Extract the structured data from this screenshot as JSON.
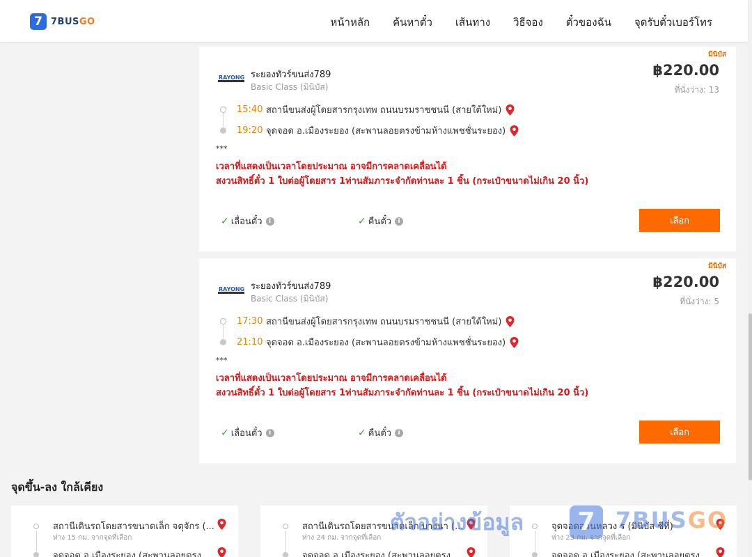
{
  "header": {
    "logo_badge": "7",
    "logo_text_main": "7BUS",
    "logo_text_accent": "GO",
    "nav": [
      "หน้าหลัก",
      "ค้นหาตั๋ว",
      "เส้นทาง",
      "วิธีจอง",
      "ตั๋วของฉัน",
      "จุดรับตั๋วเบอร์โทร"
    ]
  },
  "trips": [
    {
      "class_badge": "มินิบัส",
      "company_logo_text": "RAYONG",
      "company": "ระยองทัวร์ขนส่ง789",
      "class": "Basic Class (มินิบัส)",
      "price": "฿220.00",
      "seats": "ที่นั่งว่าง: 13",
      "depart_time": "15:40",
      "depart_place": "สถานีขนส่งผู้โดยสารกรุงเทพ ถนนบรมราชชนนี (สายใต้ใหม่)",
      "arrive_time": "19:20",
      "arrive_place": "จุดจอด อ.เมืองระยอง (สะพานลอยตรงข้ามห้างแพชชั่นระยอง)",
      "note_stars": "***",
      "note_1": "เวลาที่แสดงเป็นเวลาโดยประมาณ อาจมีการคลาดเคลื่อนได้",
      "note_2": "สงวนสิทธิ์ตั๋ว 1 ใบต่อผู้โดยสาร 1ท่านสัมภาระจำกัดท่านละ 1 ชิ้น (กระเป๋าขนาดไม่เกิน 20 นิ้ว)",
      "feature_1": "เลื่อนตั๋ว",
      "feature_2": "คืนตั๋ว",
      "select_label": "เลือก"
    },
    {
      "class_badge": "มินิบัส",
      "company_logo_text": "RAYONG",
      "company": "ระยองทัวร์ขนส่ง789",
      "class": "Basic Class (มินิบัส)",
      "price": "฿220.00",
      "seats": "ที่นั่งว่าง: 5",
      "depart_time": "17:30",
      "depart_place": "สถานีขนส่งผู้โดยสารกรุงเทพ ถนนบรมราชชนนี (สายใต้ใหม่)",
      "arrive_time": "21:10",
      "arrive_place": "จุดจอด อ.เมืองระยอง (สะพานลอยตรงข้ามห้างแพชชั่นระยอง)",
      "note_stars": "***",
      "note_1": "เวลาที่แสดงเป็นเวลาโดยประมาณ อาจมีการคลาดเคลื่อนได้",
      "note_2": "สงวนสิทธิ์ตั๋ว 1 ใบต่อผู้โดยสาร 1ท่านสัมภาระจำกัดท่านละ 1 ชิ้น (กระเป๋าขนาดไม่เกิน 20 นิ้ว)",
      "feature_1": "เลื่อนตั๋ว",
      "feature_2": "คืนตั๋ว",
      "select_label": "เลือก"
    }
  ],
  "nearby": {
    "title": "จุดขึ้น-ลง ใกล้เคียง",
    "cards": [
      {
        "from": "สถานีเดินรถโดยสารขนาดเล็ก จตุจักร (...",
        "distance": "ห่าง 15 กม. จากจุดที่เลือก",
        "to": "จุดจอด อ.เมืองระยอง (สะพานลอยตรง..."
      },
      {
        "from": "สถานีเดินรถโดยสารขนาดเล็ก บางนา (...",
        "distance": "ห่าง 24 กม. จากจุดที่เลือก",
        "to": "จุดจอด อ.เมืองระยอง (สะพานลอยตรง..."
      },
      {
        "from": "จุดจอดสวนหลวง ร (มินิบัส ชีที่)",
        "distance": "ห่าง 23 กม. จากจุดที่เลือก",
        "to": "จุดจอด อ.เมืองระยอง (สะพานลอยตรง..."
      }
    ]
  },
  "watermark": {
    "text": "ตัวอย่างข้อมูล",
    "badge": "7",
    "brand_main": "7BUS",
    "brand_accent": "GO"
  },
  "colors": {
    "accent": "#ff6a00",
    "time": "#e88400",
    "warning": "#e01616",
    "brand_blue": "#2d6be0",
    "pin": "#e0262b"
  },
  "icons": {
    "pin": "location-pin-icon",
    "check": "check-icon",
    "info": "info-icon"
  }
}
